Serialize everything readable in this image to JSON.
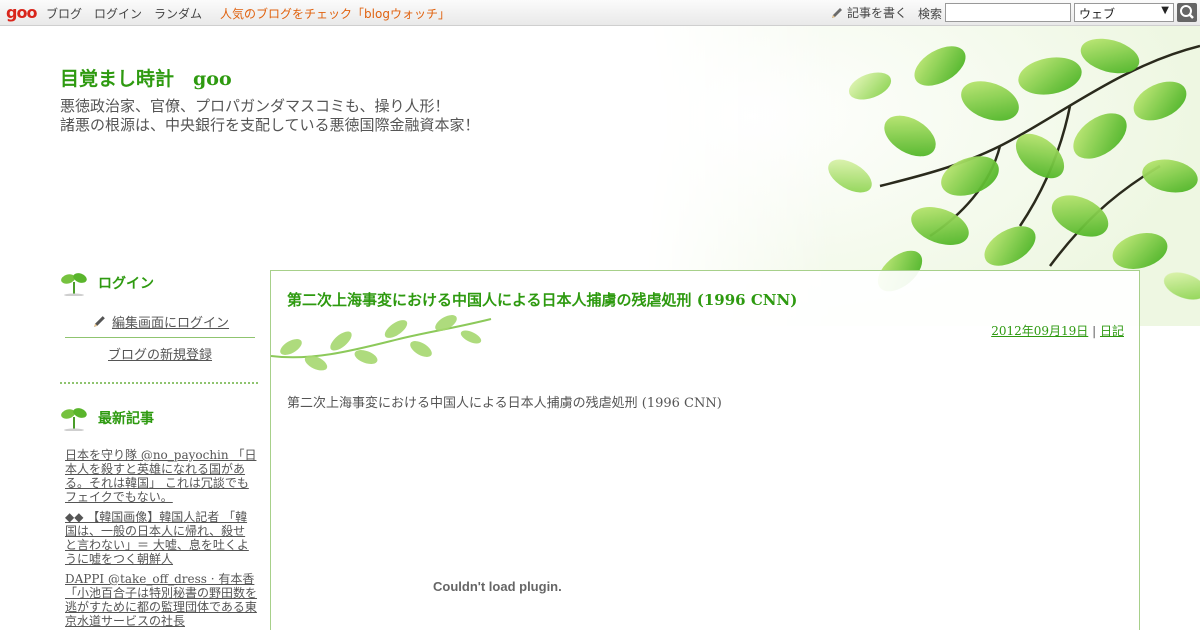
{
  "topbar": {
    "logo": "goo",
    "nav": [
      "ブログ",
      "ログイン",
      "ランダム"
    ],
    "promo": "人気のブログをチェック「blogウォッチ」",
    "write": "記事を書く",
    "search_label": "検索",
    "search_value": "",
    "search_scope": "ウェブ",
    "search_icon": "magnifier-icon"
  },
  "header": {
    "title": "目覚まし時計　goo",
    "desc_line1": "悪徳政治家、官僚、プロパガンダマスコミも、操り人形！",
    "desc_line2": "諸悪の根源は、中央銀行を支配している悪徳国際金融資本家！"
  },
  "sidebar": {
    "login_head": "ログイン",
    "login_link": "編集画面にログイン",
    "register_link": "ブログの新規登録",
    "recent_head": "最新記事",
    "recent": [
      "日本を守り隊 @no_payochin 「日本人を殺すと英雄になれる国がある。それは韓国」 これは冗談でもフェイクでもない。",
      "◆◆ 【韓国画像】韓国人記者 「韓国は、一般の日本人に帰れ、殺せと言わない」＝ 大嘘、息を吐くように嘘をつく朝鮮人",
      "DAPPI @take_off_dress · 有本香 「小池百合子は特別秘書の野田数を逃がすために都の監理団体である東京水道サービスの社長"
    ]
  },
  "post": {
    "title": "第二次上海事変における中国人による日本人捕虜の残虐処刑 (1996 CNN)",
    "date": "2012年09月19日",
    "separator": "|",
    "category": "日記",
    "body": "第二次上海事変における中国人による日本人捕虜の残虐処刑 (1996 CNN)",
    "plugin_error": "Couldn't load plugin."
  },
  "colors": {
    "accent_green": "#2e9a10",
    "promo_orange": "#e0620f",
    "logo_red": "#d9261c"
  }
}
